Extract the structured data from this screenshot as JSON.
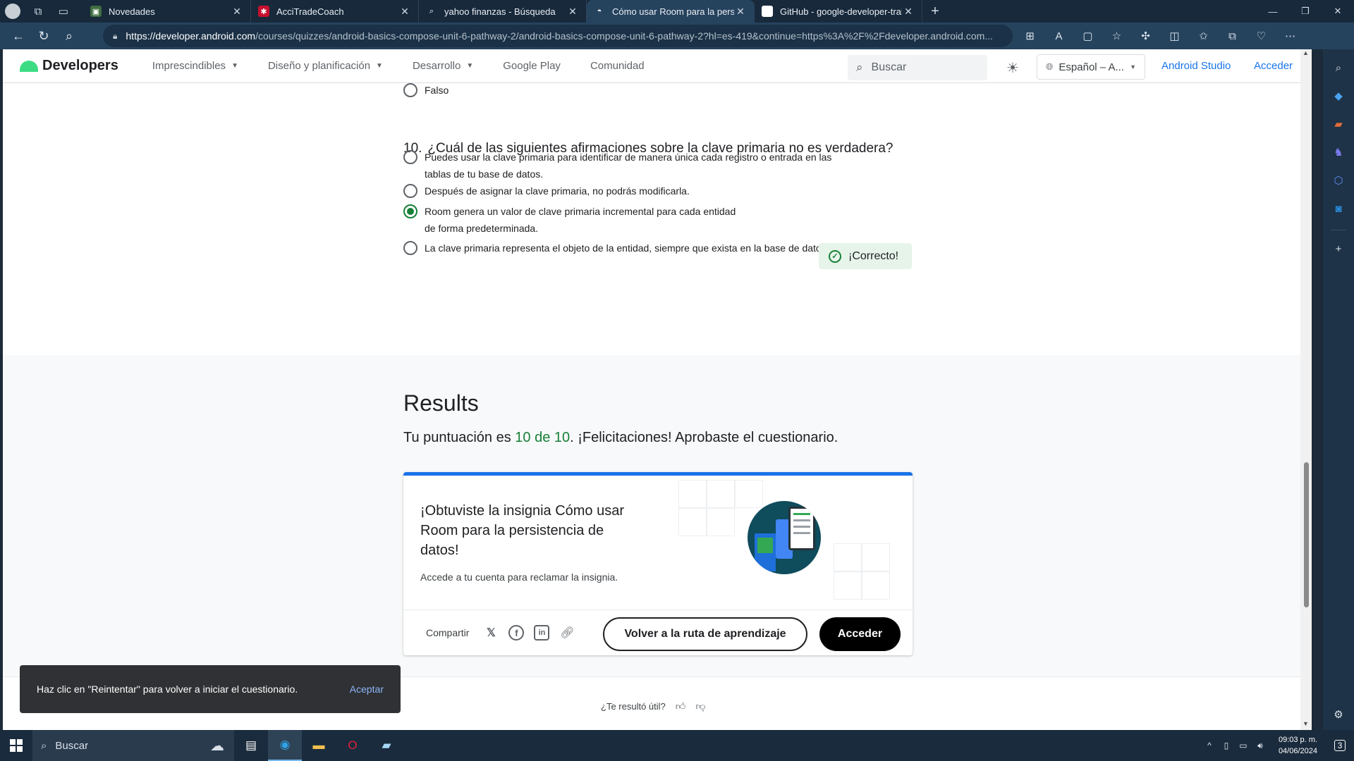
{
  "browser": {
    "tabs": [
      {
        "title": "Novedades",
        "active": false,
        "fav_color": "#3f6e3f",
        "fav_glyph": "▣"
      },
      {
        "title": "AcciTradeCoach",
        "active": false,
        "fav_color": "#c8102e",
        "fav_glyph": "✱"
      },
      {
        "title": "yahoo finanzas - Búsqueda",
        "active": false,
        "fav_color": "#17293b",
        "fav_glyph": "⌕"
      },
      {
        "title": "Cómo usar Room para la persistencia",
        "active": true,
        "fav_color": "#26435e",
        "fav_glyph": "◓"
      },
      {
        "title": "GitHub - google-developer-train",
        "active": false,
        "fav_color": "#ffffff",
        "fav_glyph": "●"
      }
    ],
    "url_host": "https://developer.android.com",
    "url_rest": "/courses/quizzes/android-basics-compose-unit-6-pathway-2/android-basics-compose-unit-6-pathway-2?hl=es-419&continue=https%3A%2F%2Fdeveloper.android.com..."
  },
  "site": {
    "logo": "Developers",
    "nav": [
      "Imprescindibles",
      "Diseño y planificación",
      "Desarrollo",
      "Google Play",
      "Comunidad"
    ],
    "nav_has_caret": [
      true,
      true,
      true,
      false,
      false
    ],
    "search_placeholder": "Buscar",
    "language": "Español – A...",
    "android_studio": "Android Studio",
    "signin": "Acceder"
  },
  "quiz": {
    "prev_option": "Falso",
    "q_number": "10.",
    "q_text": "¿Cuál de las siguientes afirmaciones sobre la clave primaria no es verdadera?",
    "options": [
      {
        "text": "Puedes usar la clave primaria para identificar de manera única cada registro o entrada en las tablas de tu base de datos.",
        "selected": false
      },
      {
        "text": "Después de asignar la clave primaria, no podrás modificarla.",
        "selected": false
      },
      {
        "text": "Room genera un valor de clave primaria incremental para cada entidad de forma predeterminada.",
        "selected": true
      },
      {
        "text": "La clave primaria representa el objeto de la entidad, siempre que exista en la base de datos.",
        "selected": false
      }
    ],
    "correct_label": "¡Correcto!"
  },
  "results": {
    "title": "Results",
    "score_prefix": "Tu puntuación es ",
    "score": "10 de 10",
    "score_suffix": ". ¡Felicitaciones! Aprobaste el cuestionario.",
    "badge_prefix": "¡Obtuviste la insignia ",
    "badge_name": "Cómo usar Room para la persistencia de datos",
    "badge_suffix": "!",
    "badge_note": "Accede a tu cuenta para reclamar la insignia.",
    "share_label": "Compartir",
    "back_button": "Volver a la ruta de aprendizaje",
    "signin_button": "Acceder"
  },
  "feedback": {
    "question": "¿Te resultó útil?"
  },
  "toast": {
    "message": "Haz clic en \"Reintentar\" para volver a iniciar el cuestionario.",
    "action": "Aceptar"
  },
  "taskbar": {
    "search": "Buscar",
    "time": "09:03 p. m.",
    "date": "04/06/2024",
    "notifications": "3"
  }
}
